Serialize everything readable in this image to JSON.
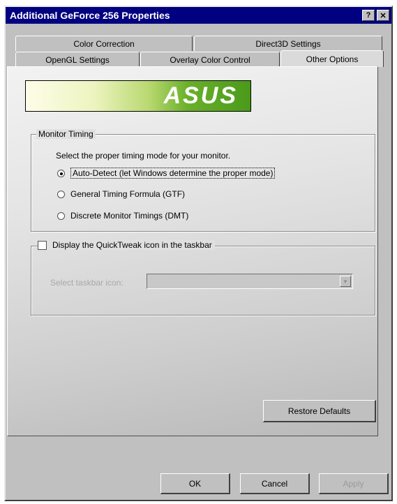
{
  "window": {
    "title": "Additional GeForce 256 Properties",
    "help_glyph": "?",
    "close_glyph": "✕"
  },
  "tabs": {
    "row_back": [
      "Color Correction",
      "Direct3D Settings"
    ],
    "row_front": [
      "OpenGL Settings",
      "Overlay Color Control",
      "Other Options"
    ],
    "active": "Other Options"
  },
  "logo": {
    "text": "ASUS"
  },
  "monitor_timing": {
    "legend": "Monitor Timing",
    "instruction": "Select the proper timing mode for your monitor.",
    "options": [
      {
        "label": "Auto-Detect (let Windows determine the proper mode)",
        "selected": true
      },
      {
        "label": "General Timing Formula (GTF)",
        "selected": false
      },
      {
        "label": "Discrete Monitor Timings (DMT)",
        "selected": false
      }
    ]
  },
  "quicktweak": {
    "checkbox_label": "Display the QuickTweak icon in the taskbar",
    "checked": false,
    "select_label": "Select taskbar icon:",
    "select_value": ""
  },
  "buttons": {
    "restore": "Restore Defaults",
    "ok": "OK",
    "cancel": "Cancel",
    "apply": "Apply"
  },
  "colors": {
    "titlebar": "#000080",
    "logo_green": "#4a9a1a"
  }
}
